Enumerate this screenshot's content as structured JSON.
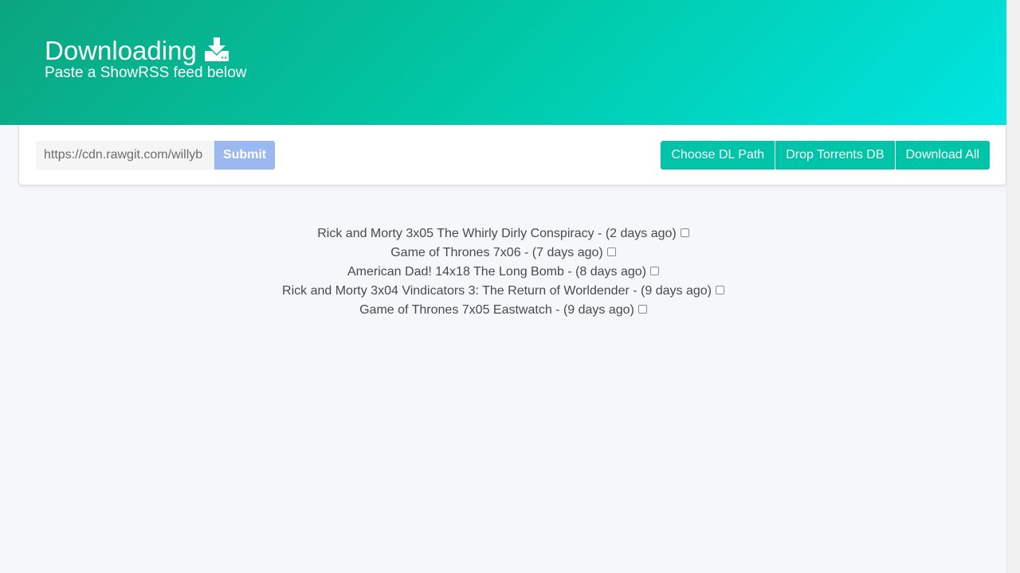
{
  "header": {
    "title": "Downloading",
    "subtitle": "Paste a ShowRSS feed below",
    "icon": "download-icon"
  },
  "feed": {
    "input_value": "https://cdn.rawgit.com/willyb",
    "submit_label": "Submit"
  },
  "actions": {
    "choose_path_label": "Choose DL Path",
    "drop_db_label": "Drop Torrents DB",
    "download_all_label": "Download All"
  },
  "episodes": [
    {
      "label": "Rick and Morty 3x05 The Whirly Dirly Conspiracy - (2 days ago)",
      "checked": false
    },
    {
      "label": "Game of Thrones 7x06 - (7 days ago)",
      "checked": false
    },
    {
      "label": "American Dad! 14x18 The Long Bomb - (8 days ago)",
      "checked": false
    },
    {
      "label": "Rick and Morty 3x04 Vindicators 3: The Return of Worldender - (9 days ago)",
      "checked": false
    },
    {
      "label": "Game of Thrones 7x05 Eastwatch - (9 days ago)",
      "checked": false
    }
  ],
  "colors": {
    "hero_start": "#0ba57f",
    "hero_end": "#00e5e2",
    "primary_button": "#00c4a7",
    "submit_button": "#9bb8f0"
  }
}
